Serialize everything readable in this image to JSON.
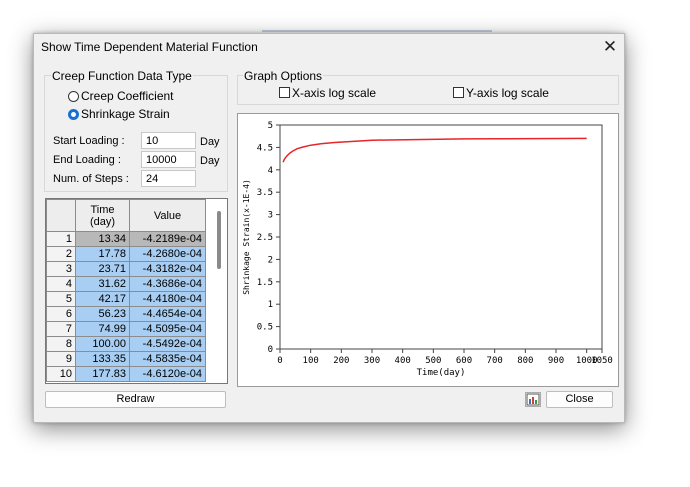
{
  "window": {
    "title": "Show Time Dependent Material Function"
  },
  "creep_group": {
    "label": "Creep Function Data Type",
    "options": [
      {
        "label": "Creep Coefficient",
        "checked": false
      },
      {
        "label": "Shrinkage Strain",
        "checked": true
      }
    ]
  },
  "fields": {
    "start": {
      "label": "Start Loading :",
      "value": "10",
      "unit": "Day"
    },
    "end": {
      "label": "End Loading :",
      "value": "10000",
      "unit": "Day"
    },
    "steps": {
      "label": "Num. of Steps :",
      "value": "24"
    }
  },
  "graph_options": {
    "label": "Graph Options",
    "x_log": {
      "label": "X-axis log scale",
      "checked": false
    },
    "y_log": {
      "label": "Y-axis log scale",
      "checked": false
    }
  },
  "table": {
    "headers": [
      "Time\n(day)",
      "Value"
    ],
    "rows": [
      [
        "1",
        "13.34",
        "-4.2189e-04"
      ],
      [
        "2",
        "17.78",
        "-4.2680e-04"
      ],
      [
        "3",
        "23.71",
        "-4.3182e-04"
      ],
      [
        "4",
        "31.62",
        "-4.3686e-04"
      ],
      [
        "5",
        "42.17",
        "-4.4180e-04"
      ],
      [
        "6",
        "56.23",
        "-4.4654e-04"
      ],
      [
        "7",
        "74.99",
        "-4.5095e-04"
      ],
      [
        "8",
        "100.00",
        "-4.5492e-04"
      ],
      [
        "9",
        "133.35",
        "-4.5835e-04"
      ],
      [
        "10",
        "177.83",
        "-4.6120e-04"
      ]
    ]
  },
  "buttons": {
    "redraw": "Redraw",
    "close": "Close"
  },
  "icons": {
    "close": "close-icon",
    "export": "chart-export-icon"
  },
  "colors": {
    "accent": "#1a6fcf",
    "series": "#e8252a",
    "selected_cell": "#a8cff3"
  },
  "chart_data": {
    "type": "line",
    "xlabel": "Time(day)",
    "ylabel": "Shrinkage Strain(x-1E-4)",
    "xlim": [
      0,
      1050
    ],
    "ylim": [
      0,
      5
    ],
    "xticks": [
      0,
      100,
      200,
      300,
      400,
      500,
      600,
      700,
      800,
      900,
      1000,
      1050
    ],
    "yticks": [
      0,
      0.5,
      1,
      1.5,
      2,
      2.5,
      3,
      3.5,
      4,
      4.5,
      5
    ],
    "series": [
      {
        "x": [
          10,
          13.34,
          17.78,
          23.71,
          31.62,
          42.17,
          56.23,
          74.99,
          100,
          133.35,
          177.83,
          300,
          600,
          1000
        ],
        "y": [
          4.17,
          4.22,
          4.27,
          4.32,
          4.37,
          4.42,
          4.47,
          4.51,
          4.55,
          4.58,
          4.61,
          4.66,
          4.69,
          4.7
        ]
      }
    ]
  }
}
